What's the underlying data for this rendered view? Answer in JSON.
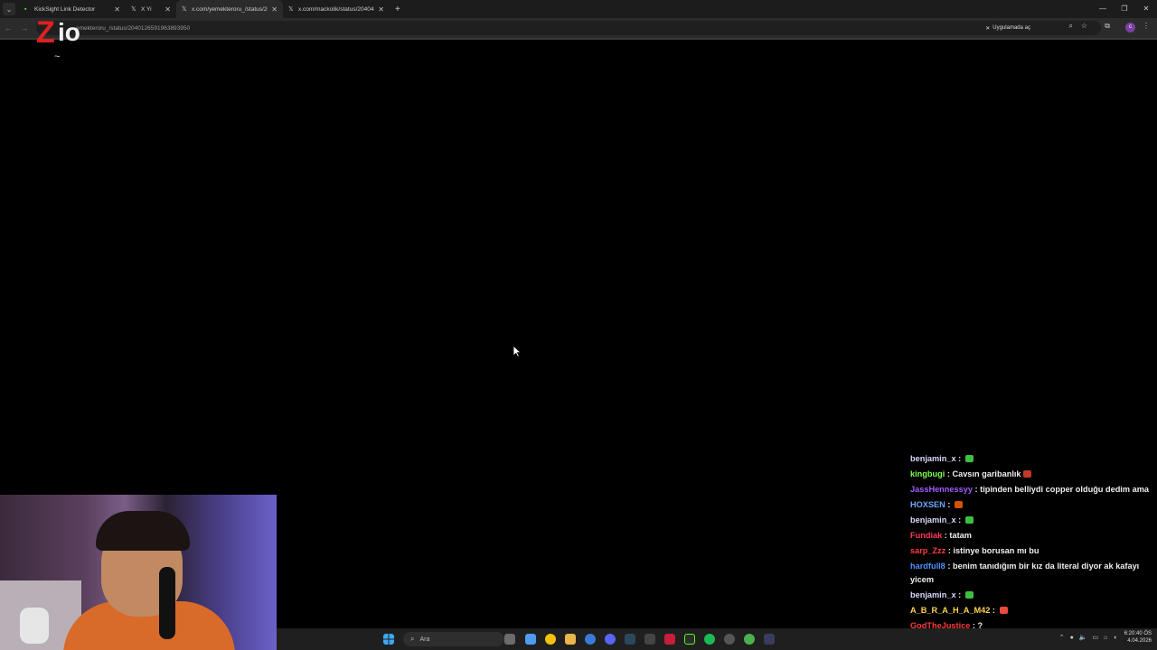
{
  "browser": {
    "tabs": [
      {
        "title": "KickSight Link Detector",
        "icon": "kick-icon",
        "active": false
      },
      {
        "title": "X Yi",
        "icon": "x-icon",
        "active": false
      },
      {
        "title": "x.com/yemekteroru_/status/20",
        "icon": "x-icon",
        "active": true
      },
      {
        "title": "x.com/mackolik/status/204048",
        "icon": "x-icon",
        "active": false
      }
    ],
    "url": "emekteroru_/status/2040126591963893950",
    "open_in_app_label": "Uygulamada aç",
    "profile_initial": "c"
  },
  "overlay": {
    "logo_text": "Zio",
    "tilde": "~"
  },
  "chat": {
    "messages": [
      {
        "user": "benjamin_x",
        "color": "#d9d9ff",
        "text": "",
        "emote_color": "#3fbf3f"
      },
      {
        "user": "kingbugi",
        "color": "#7fff4f",
        "text": "Cavsın garibanlık",
        "emote_color": "#c0392b"
      },
      {
        "user": "JassHennessyy",
        "color": "#a45cff",
        "text": "tipinden belliydi copper olduğu dedim ama",
        "emote_color": ""
      },
      {
        "user": "HOXSEN",
        "color": "#6fa8ff",
        "text": "",
        "emote_color": "#d35400"
      },
      {
        "user": "benjamin_x",
        "color": "#d9d9ff",
        "text": "",
        "emote_color": "#3fbf3f"
      },
      {
        "user": "Fundiak",
        "color": "#ff3b5c",
        "text": "tatam",
        "emote_color": ""
      },
      {
        "user": "sarp_Zzz",
        "color": "#ff3b3b",
        "text": "istinye borusan mı bu",
        "emote_color": ""
      },
      {
        "user": "hardfull8",
        "color": "#4f8fff",
        "text": "benim tanıdığım bir kız da literal diyor ak kafayı yicem",
        "emote_color": ""
      },
      {
        "user": "benjamin_x",
        "color": "#d9d9ff",
        "text": "",
        "emote_color": "#3fbf3f"
      },
      {
        "user": "A_B_R_A_H_A_M42",
        "color": "#ffd24f",
        "text": "",
        "emote_color": "#e74c3c"
      },
      {
        "user": "GodTheJustice",
        "color": "#ff3b3b",
        "text": "?",
        "emote_color": ""
      }
    ]
  },
  "taskbar": {
    "search_placeholder": "Ara",
    "time": "6:20:40 ÖS",
    "date": "4.04.2026"
  }
}
